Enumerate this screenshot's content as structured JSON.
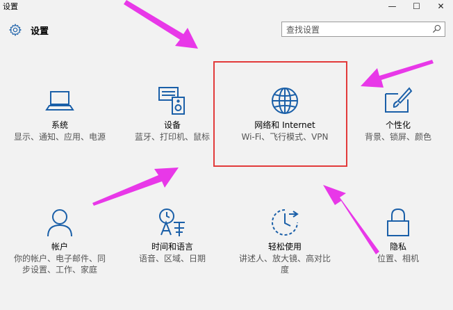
{
  "window": {
    "title": "设置",
    "controls": {
      "minimize": "—",
      "maximize": "☐",
      "close": "✕"
    }
  },
  "header": {
    "title": "设置",
    "icon": "gear-icon"
  },
  "search": {
    "placeholder": "查找设置",
    "value": ""
  },
  "tiles": [
    {
      "name": "系统",
      "desc": "显示、通知、应用、电源",
      "icon": "laptop-icon"
    },
    {
      "name": "设备",
      "desc": "蓝牙、打印机、鼠标",
      "icon": "devices-icon"
    },
    {
      "name": "网络和 Internet",
      "desc": "Wi-Fi、飞行模式、VPN",
      "icon": "globe-icon"
    },
    {
      "name": "个性化",
      "desc": "背景、锁屏、颜色",
      "icon": "personalize-icon"
    },
    {
      "name": "帐户",
      "desc": "你的帐户、电子邮件、同步设置、工作、家庭",
      "icon": "person-icon"
    },
    {
      "name": "时间和语言",
      "desc": "语音、区域、日期",
      "icon": "time-language-icon"
    },
    {
      "name": "轻松使用",
      "desc": "讲述人、放大镜、高对比度",
      "icon": "ease-of-access-icon"
    },
    {
      "name": "隐私",
      "desc": "位置、相机",
      "icon": "lock-icon"
    }
  ],
  "colors": {
    "accent": "#1a5fa8",
    "highlight": "#e23a3a",
    "annotation_arrow": "#e838e8"
  }
}
